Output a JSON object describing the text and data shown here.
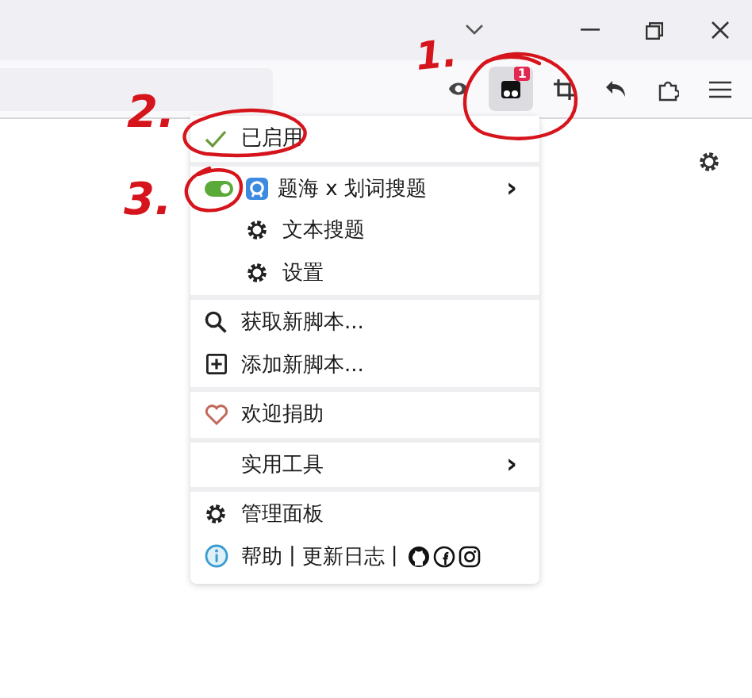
{
  "toolbar": {
    "extension_badge": "1"
  },
  "menu": {
    "sections": [
      {
        "items": [
          {
            "kind": "status",
            "label": "已启用",
            "checked": true
          }
        ]
      },
      {
        "items": [
          {
            "kind": "script",
            "label": "题海 x 划词搜题",
            "enabled": true,
            "submenu": "›"
          },
          {
            "kind": "command",
            "label": "文本搜题"
          },
          {
            "kind": "command",
            "label": "设置"
          }
        ]
      },
      {
        "items": [
          {
            "kind": "find",
            "label": "获取新脚本..."
          },
          {
            "kind": "create",
            "label": "添加新脚本..."
          }
        ]
      },
      {
        "items": [
          {
            "kind": "donate",
            "label": "欢迎捐助"
          }
        ]
      },
      {
        "items": [
          {
            "kind": "tools",
            "label": "实用工具",
            "submenu": "›"
          }
        ]
      },
      {
        "items": [
          {
            "kind": "dashboard",
            "label": "管理面板"
          },
          {
            "kind": "help",
            "links": [
              "帮助",
              "更新日志"
            ],
            "separator": "|"
          }
        ]
      }
    ]
  },
  "annotations": [
    {
      "label": "1."
    },
    {
      "label": "2."
    },
    {
      "label": "3."
    }
  ]
}
